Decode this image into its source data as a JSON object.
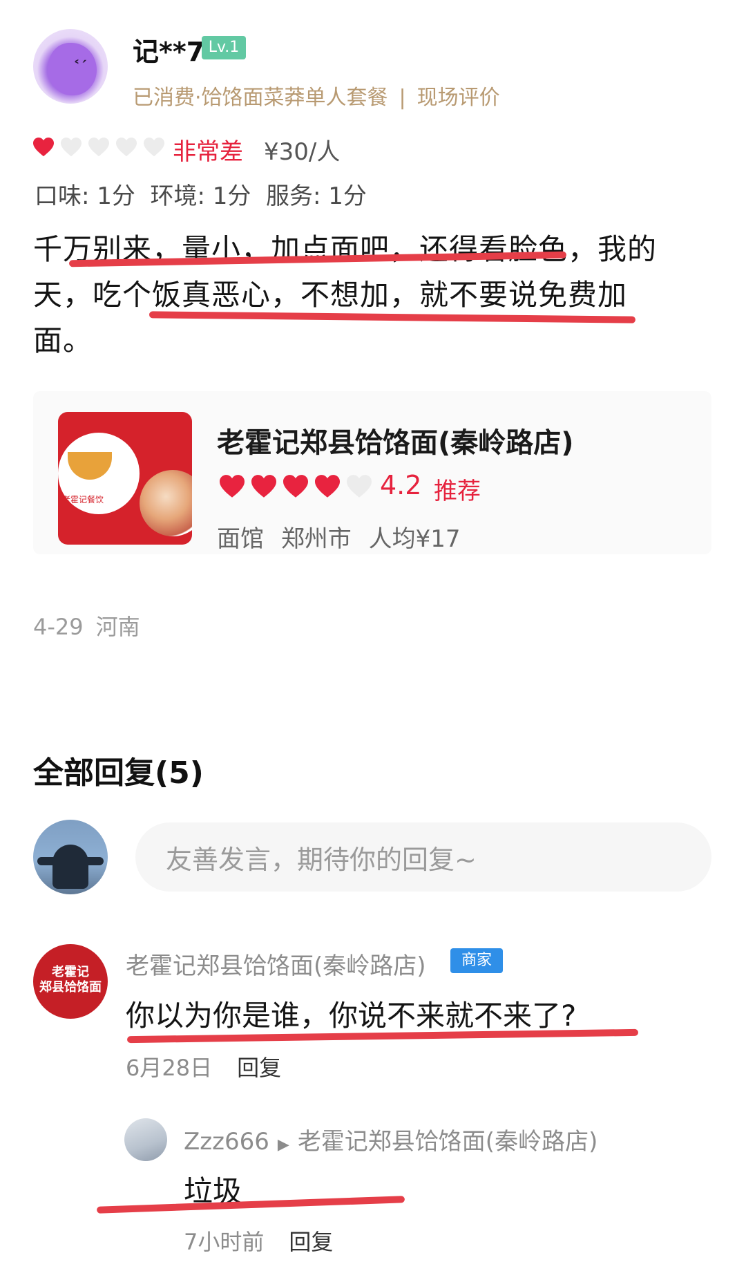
{
  "reviewer": {
    "name": "记**7",
    "level": "Lv.1",
    "purchase": "已消费·饸饹面菜莽单人套餐",
    "source": "现场评价",
    "rating_hearts": 1,
    "rating_label": "非常差",
    "price_per_person": "¥30/人",
    "sub_scores": "口味: 1分  环境: 1分  服务: 1分"
  },
  "review": {
    "line1": "千万别来，量小，加点面吧，还得看脸色，我的",
    "line2": "天，吃个饭真恶心，不想加，就不要说免费加",
    "line3": "面。"
  },
  "shop": {
    "name": "老霍记郑县饸饹面(秦岭路店)",
    "hearts": 4,
    "score": "4.2",
    "recommend": "推荐",
    "category": "面馆",
    "city": "郑州市",
    "avg_price": "人均¥17",
    "logo_text": "老霍记餐饮"
  },
  "post_meta": {
    "date": "4-29",
    "location": "河南"
  },
  "replies": {
    "title": "全部回复(5)",
    "input_placeholder": "友善发言，期待你的回复~",
    "items": [
      {
        "author": "老霍记郑县饸饹面(秦岭路店)",
        "badge": "商家",
        "avatar_text": "老霍记\n郑县饸饹面",
        "text": "你以为你是谁，你说不来就不来了?",
        "time": "6月28日",
        "reply_label": "回复"
      },
      {
        "author": "Zzz666",
        "reply_to": "老霍记郑县饸饹面(秦岭路店)",
        "text": "垃圾",
        "time": "7小时前",
        "reply_label": "回复"
      }
    ]
  },
  "colors": {
    "accent_red": "#e6223d",
    "underline_red": "#e53e48",
    "level_green": "#62c9a3",
    "merchant_blue": "#2f8fe8",
    "purchase_gold": "#b89a72"
  }
}
